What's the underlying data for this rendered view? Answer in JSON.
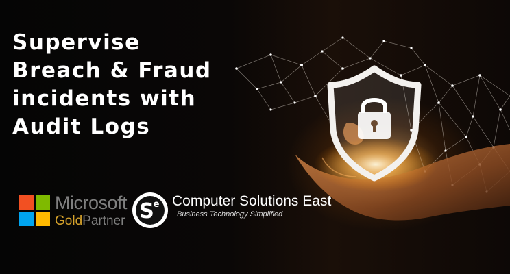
{
  "headline": {
    "lines": [
      "Supervise",
      "Breach & Fraud",
      "incidents with",
      "Audit Logs"
    ]
  },
  "microsoft": {
    "word": "Microsoft",
    "gold": "Gold",
    "partner": "Partner",
    "colors": [
      "#f25022",
      "#7fba00",
      "#00a4ef",
      "#ffb900"
    ]
  },
  "company": {
    "logo_text": "Se",
    "name": "Computer Solutions East",
    "tagline": "Business Technology Simplified"
  },
  "imagery": {
    "icons": [
      "shield-icon",
      "padlock-icon",
      "hand-icon",
      "network-mesh"
    ],
    "accent": "#ffb347"
  }
}
